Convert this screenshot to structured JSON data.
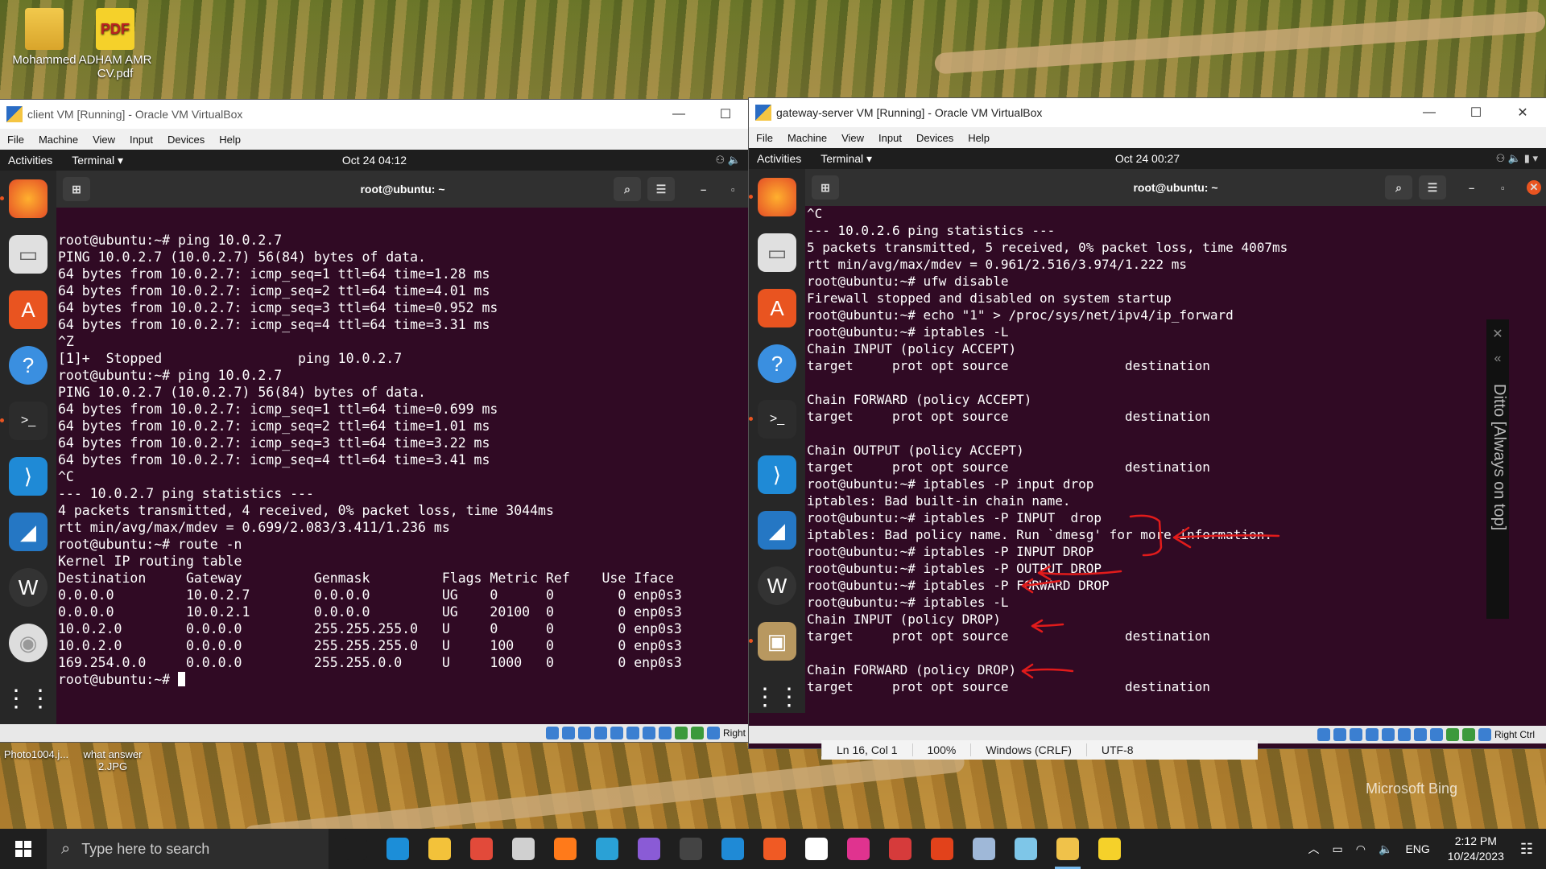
{
  "desktop": {
    "icons": [
      {
        "label": "Mohammed",
        "icon": "folder-user-icon"
      },
      {
        "label": "ADHAM AMR CV.pdf",
        "icon": "pdf-file-icon"
      }
    ],
    "bottom_icons": [
      {
        "label": "Photo1004.j..."
      },
      {
        "label": "what answer 2.JPG"
      }
    ],
    "watermark": "Microsoft Bing"
  },
  "client_vm": {
    "title": "client VM [Running] - Oracle VM VirtualBox",
    "menu": [
      "File",
      "Machine",
      "View",
      "Input",
      "Devices",
      "Help"
    ],
    "gnome": {
      "activities": "Activities",
      "app": "Terminal ▾",
      "clock": "Oct 24  04:12"
    },
    "terminal_title": "root@ubuntu: ~",
    "status_right": "Right",
    "lines": [
      "root@ubuntu:~# ping 10.0.2.7",
      "PING 10.0.2.7 (10.0.2.7) 56(84) bytes of data.",
      "64 bytes from 10.0.2.7: icmp_seq=1 ttl=64 time=1.28 ms",
      "64 bytes from 10.0.2.7: icmp_seq=2 ttl=64 time=4.01 ms",
      "64 bytes from 10.0.2.7: icmp_seq=3 ttl=64 time=0.952 ms",
      "64 bytes from 10.0.2.7: icmp_seq=4 ttl=64 time=3.31 ms",
      "^Z",
      "[1]+  Stopped                 ping 10.0.2.7",
      "root@ubuntu:~# ping 10.0.2.7",
      "PING 10.0.2.7 (10.0.2.7) 56(84) bytes of data.",
      "64 bytes from 10.0.2.7: icmp_seq=1 ttl=64 time=0.699 ms",
      "64 bytes from 10.0.2.7: icmp_seq=2 ttl=64 time=1.01 ms",
      "64 bytes from 10.0.2.7: icmp_seq=3 ttl=64 time=3.22 ms",
      "64 bytes from 10.0.2.7: icmp_seq=4 ttl=64 time=3.41 ms",
      "^C",
      "--- 10.0.2.7 ping statistics ---",
      "4 packets transmitted, 4 received, 0% packet loss, time 3044ms",
      "rtt min/avg/max/mdev = 0.699/2.083/3.411/1.236 ms",
      "root@ubuntu:~# route -n",
      "Kernel IP routing table",
      "Destination     Gateway         Genmask         Flags Metric Ref    Use Iface",
      "0.0.0.0         10.0.2.7        0.0.0.0         UG    0      0        0 enp0s3",
      "0.0.0.0         10.0.2.1        0.0.0.0         UG    20100  0        0 enp0s3",
      "10.0.2.0        0.0.0.0         255.255.255.0   U     0      0        0 enp0s3",
      "10.0.2.0        0.0.0.0         255.255.255.0   U     100    0        0 enp0s3",
      "169.254.0.0     0.0.0.0         255.255.0.0     U     1000   0        0 enp0s3"
    ],
    "prompt": "root@ubuntu:~# "
  },
  "gateway_vm": {
    "title": "gateway-server VM [Running] - Oracle VM VirtualBox",
    "menu": [
      "File",
      "Machine",
      "View",
      "Input",
      "Devices",
      "Help"
    ],
    "gnome": {
      "activities": "Activities",
      "app": "Terminal ▾",
      "clock": "Oct 24  00:27"
    },
    "terminal_title": "root@ubuntu: ~",
    "status_right": "Right Ctrl",
    "lines": [
      "^C",
      "--- 10.0.2.6 ping statistics ---",
      "5 packets transmitted, 5 received, 0% packet loss, time 4007ms",
      "rtt min/avg/max/mdev = 0.961/2.516/3.974/1.222 ms",
      "root@ubuntu:~# ufw disable",
      "Firewall stopped and disabled on system startup",
      "root@ubuntu:~# echo \"1\" > /proc/sys/net/ipv4/ip_forward",
      "root@ubuntu:~# iptables -L",
      "Chain INPUT (policy ACCEPT)",
      "target     prot opt source               destination",
      "",
      "Chain FORWARD (policy ACCEPT)",
      "target     prot opt source               destination",
      "",
      "Chain OUTPUT (policy ACCEPT)",
      "target     prot opt source               destination",
      "root@ubuntu:~# iptables -P input drop",
      "iptables: Bad built-in chain name.",
      "root@ubuntu:~# iptables -P INPUT  drop",
      "iptables: Bad policy name. Run `dmesg' for more information.",
      "root@ubuntu:~# iptables -P INPUT DROP",
      "root@ubuntu:~# iptables -P OUTPUT DROP",
      "root@ubuntu:~# iptables -P FORWARD DROP",
      "root@ubuntu:~# iptables -L",
      "Chain INPUT (policy DROP)",
      "target     prot opt source               destination",
      "",
      "Chain FORWARD (policy DROP)",
      "target     prot opt source               destination",
      "",
      "Chain OUTPUT (policy DROP)",
      "target     prot opt source               destination"
    ],
    "prompt": "root@ubuntu:~# "
  },
  "ditto": {
    "label": "Ditto [Always on top]"
  },
  "notepad_status": {
    "position": "Ln 16, Col 1",
    "zoom": "100%",
    "eol": "Windows (CRLF)",
    "encoding": "UTF-8"
  },
  "taskbar": {
    "search_placeholder": "Type here to search",
    "language": "ENG",
    "time": "2:12 PM",
    "date": "10/24/2023",
    "apps": [
      {
        "icon": "task-view-icon",
        "color": "#1f1f1f"
      },
      {
        "icon": "edge-icon",
        "color": "#1c8ed8"
      },
      {
        "icon": "file-explorer-icon",
        "color": "#f3c23a"
      },
      {
        "icon": "chrome-icon",
        "color": "#e24a3a"
      },
      {
        "icon": "app-icon",
        "color": "#d0d0d0"
      },
      {
        "icon": "firefox-icon",
        "color": "#ff7a1a"
      },
      {
        "icon": "azure-data-icon",
        "color": "#2aa1d6"
      },
      {
        "icon": "visual-studio-icon",
        "color": "#8a5bd6"
      },
      {
        "icon": "wireshark-icon",
        "color": "#444444"
      },
      {
        "icon": "vscode-icon",
        "color": "#1f8ad6"
      },
      {
        "icon": "brave-icon",
        "color": "#f05a24"
      },
      {
        "icon": "github-desktop-icon",
        "color": "#ffffff"
      },
      {
        "icon": "intellij-icon",
        "color": "#e0338f"
      },
      {
        "icon": "pdf-editor-icon",
        "color": "#d63b3b"
      },
      {
        "icon": "office-icon",
        "color": "#e2421b"
      },
      {
        "icon": "virtualbox-cube-icon",
        "color": "#9fb8d8"
      },
      {
        "icon": "notepad-icon",
        "color": "#7ec6e8"
      },
      {
        "icon": "virtualbox-icon",
        "color": "#f0c24a"
      },
      {
        "icon": "pdf-reader-icon",
        "color": "#f5d12a"
      }
    ]
  },
  "colors": {
    "terminal_bg": "#300a24",
    "accent": "#e95420",
    "annotation": "#e11b1b"
  }
}
